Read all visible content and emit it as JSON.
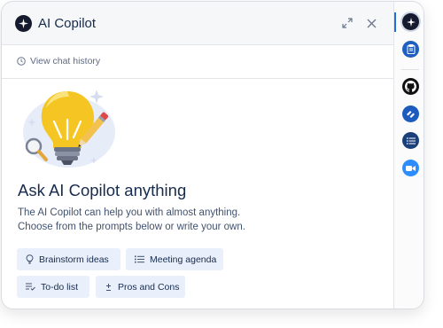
{
  "header": {
    "title": "AI Copilot",
    "logo_icon": "sparkle-icon",
    "expand_icon": "expand-icon",
    "close_icon": "close-icon"
  },
  "history": {
    "label": "View chat history",
    "icon": "clock-icon"
  },
  "main": {
    "heading": "Ask AI Copilot anything",
    "description_line1": "The AI Copilot can help you with almost anything.",
    "description_line2": "Choose from the prompts below or write your own.",
    "illustration": "lightbulb-pencil-icon"
  },
  "prompts": [
    {
      "label": "Brainstorm ideas",
      "icon": "lightbulb-icon"
    },
    {
      "label": "Meeting agenda",
      "icon": "list-icon"
    },
    {
      "label": "To-do list",
      "icon": "checklist-icon"
    },
    {
      "label": "Pros and Cons",
      "icon": "plus-minus-icon"
    }
  ],
  "sidebar": {
    "items": [
      {
        "name": "copilot",
        "icon": "sparkle-icon",
        "color": "#161a2e",
        "active": true
      },
      {
        "name": "notes",
        "icon": "clipboard-icon",
        "color": "#1f5fbf"
      },
      {
        "name": "github",
        "icon": "github-icon",
        "color": "#111111"
      },
      {
        "name": "jira",
        "icon": "jira-icon",
        "color": "#1d5bbf"
      },
      {
        "name": "list",
        "icon": "list-icon",
        "color": "#1b3f7a"
      },
      {
        "name": "zoom",
        "icon": "video-camera-icon",
        "color": "#2d8cff"
      }
    ]
  },
  "colors": {
    "accent": "#1d6fe0",
    "chip_bg": "#e9f0fb",
    "heading": "#172b4d",
    "bulb": "#f5c623"
  }
}
